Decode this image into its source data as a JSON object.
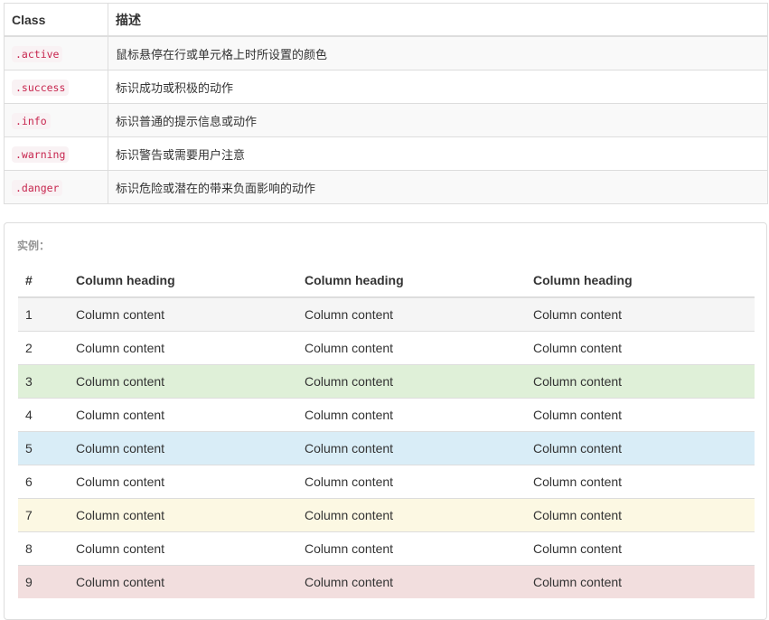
{
  "ref_table": {
    "headers": [
      "Class",
      "描述"
    ],
    "rows": [
      {
        "cls": ".active",
        "desc": "鼠标悬停在行或单元格上时所设置的颜色"
      },
      {
        "cls": ".success",
        "desc": "标识成功或积极的动作"
      },
      {
        "cls": ".info",
        "desc": "标识普通的提示信息或动作"
      },
      {
        "cls": ".warning",
        "desc": "标识警告或需要用户注意"
      },
      {
        "cls": ".danger",
        "desc": "标识危险或潜在的带来负面影响的动作"
      }
    ]
  },
  "example": {
    "label": "实例：",
    "headers": [
      "#",
      "Column heading",
      "Column heading",
      "Column heading"
    ],
    "rows": [
      {
        "state": "active",
        "cells": [
          "1",
          "Column content",
          "Column content",
          "Column content"
        ]
      },
      {
        "state": "",
        "cells": [
          "2",
          "Column content",
          "Column content",
          "Column content"
        ]
      },
      {
        "state": "success",
        "cells": [
          "3",
          "Column content",
          "Column content",
          "Column content"
        ]
      },
      {
        "state": "",
        "cells": [
          "4",
          "Column content",
          "Column content",
          "Column content"
        ]
      },
      {
        "state": "info",
        "cells": [
          "5",
          "Column content",
          "Column content",
          "Column content"
        ]
      },
      {
        "state": "",
        "cells": [
          "6",
          "Column content",
          "Column content",
          "Column content"
        ]
      },
      {
        "state": "warning",
        "cells": [
          "7",
          "Column content",
          "Column content",
          "Column content"
        ]
      },
      {
        "state": "",
        "cells": [
          "8",
          "Column content",
          "Column content",
          "Column content"
        ]
      },
      {
        "state": "danger",
        "cells": [
          "9",
          "Column content",
          "Column content",
          "Column content"
        ]
      }
    ]
  },
  "colors": {
    "active": "#f5f5f5",
    "success": "#dff0d8",
    "info": "#d9edf7",
    "warning": "#fcf8e3",
    "danger": "#f2dede",
    "code_text": "#c7254e",
    "code_bg": "#f9f2f4"
  }
}
